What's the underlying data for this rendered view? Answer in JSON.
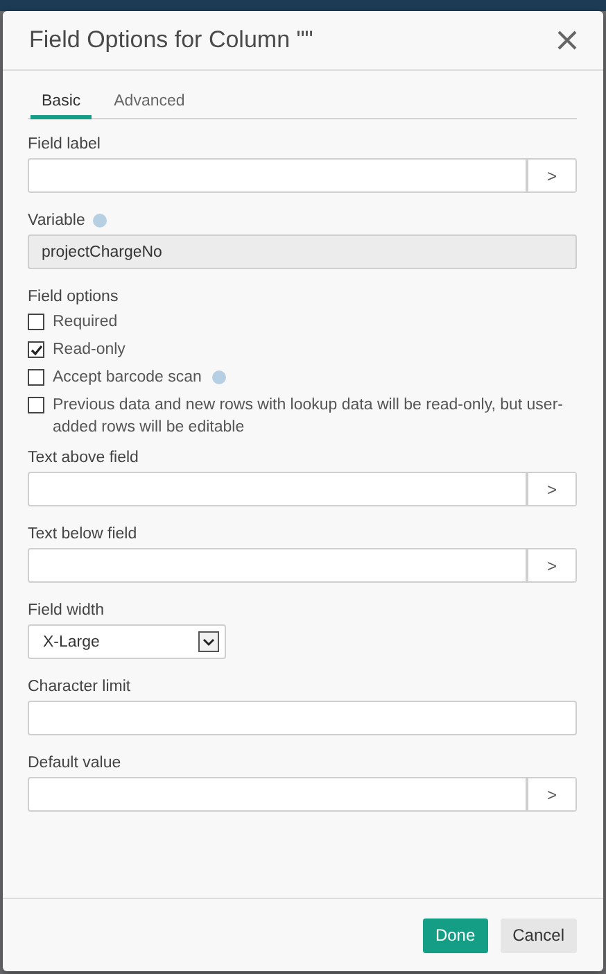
{
  "backdrop": {
    "nav_bar": true
  },
  "dialog": {
    "title": "Field Options for Column \"\"",
    "tabs": [
      {
        "label": "Basic",
        "selected": true
      },
      {
        "label": "Advanced",
        "selected": false
      }
    ],
    "sections": [
      {
        "kind": "expression",
        "label": "Field label",
        "button": ">"
      },
      {
        "kind": "readonly",
        "label": "Variable",
        "help": true,
        "value": "projectChargeNo"
      },
      {
        "kind": "options",
        "label": "Field options",
        "options": [
          {
            "label": "Required",
            "checked": false,
            "help": false
          },
          {
            "label": "Read-only",
            "checked": true,
            "help": false
          },
          {
            "label": "Accept barcode scan",
            "checked": false,
            "help": true
          },
          {
            "label": "Previous data and new rows with lookup data will be read-only, but user-added rows will be editable",
            "checked": false,
            "help": false
          }
        ]
      },
      {
        "kind": "expression",
        "label": "Text above field",
        "button": ">"
      },
      {
        "kind": "expression",
        "label": "Text below field",
        "button": ">"
      },
      {
        "kind": "select",
        "label": "Field width",
        "value": "X-Large"
      },
      {
        "kind": "text",
        "label": "Character limit"
      },
      {
        "kind": "expression",
        "label": "Default value",
        "button": ">"
      }
    ],
    "buttons": [
      {
        "label": "Done",
        "kind": "primary"
      },
      {
        "label": "Cancel",
        "kind": "secondary"
      }
    ]
  }
}
